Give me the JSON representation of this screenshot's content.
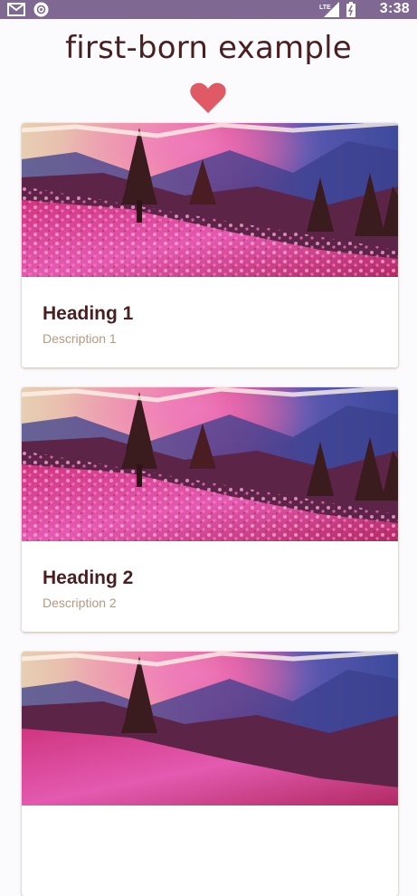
{
  "status_bar": {
    "network": "LTE",
    "time": "3:38",
    "icons": [
      "gmail-icon",
      "app-notification-icon",
      "lte-signal-icon",
      "battery-icon"
    ]
  },
  "page": {
    "title": "first-born example",
    "heart_icon": "heart-icon",
    "heart_color": "#e05a66"
  },
  "cards": [
    {
      "heading": "Heading 1",
      "description": "Description 1",
      "image": "mountain-flower-meadow"
    },
    {
      "heading": "Heading 2",
      "description": "Description 2",
      "image": "mountain-flower-meadow"
    },
    {
      "heading": "",
      "description": "",
      "image": "mountain-flower-meadow"
    }
  ],
  "colors": {
    "status_bar": "#7f6892",
    "title_text": "#4a1f22",
    "description_text": "#b39a84",
    "background": "#fbfbfe"
  }
}
